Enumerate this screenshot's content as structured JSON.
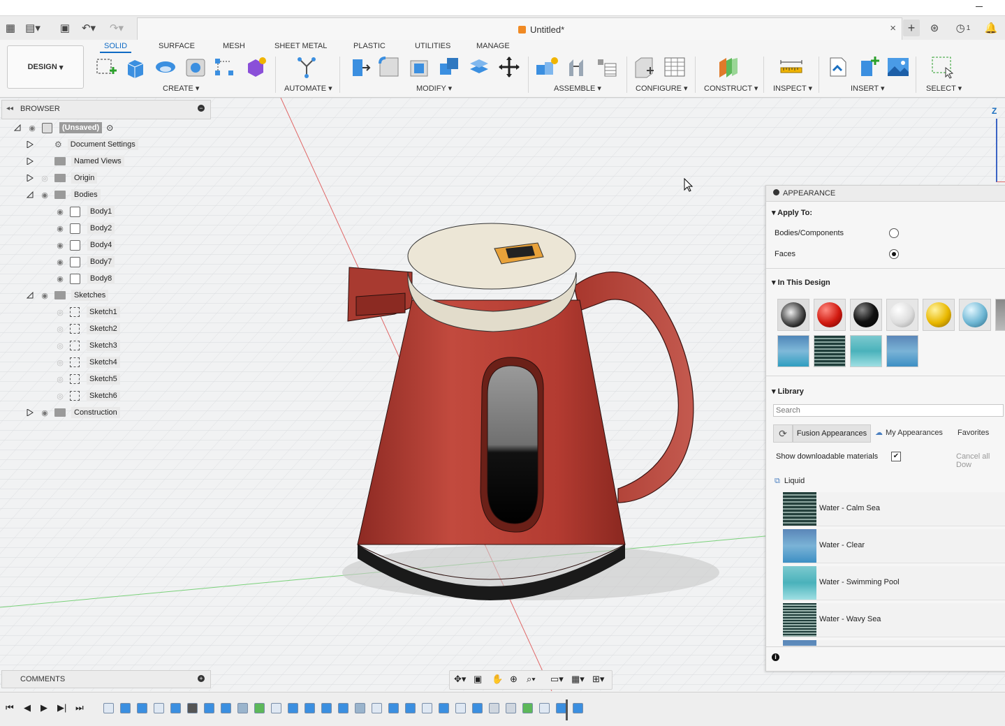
{
  "window": {
    "title": "Untitled*"
  },
  "toolbar": {
    "design_label": "DESIGN",
    "tabs": [
      {
        "label": "SOLID",
        "active": true
      },
      {
        "label": "SURFACE",
        "active": false
      },
      {
        "label": "MESH",
        "active": false
      },
      {
        "label": "SHEET METAL",
        "active": false
      },
      {
        "label": "PLASTIC",
        "active": false
      },
      {
        "label": "UTILITIES",
        "active": false
      },
      {
        "label": "MANAGE",
        "active": false
      }
    ],
    "groups": {
      "create": "CREATE",
      "automate": "AUTOMATE",
      "modify": "MODIFY",
      "assemble": "ASSEMBLE",
      "configure": "CONFIGURE",
      "construct": "CONSTRUCT",
      "inspect": "INSPECT",
      "insert": "INSERT",
      "select": "SELECT"
    }
  },
  "browser": {
    "title": "BROWSER",
    "root": "(Unsaved)",
    "items": [
      {
        "label": "Document Settings"
      },
      {
        "label": "Named Views"
      },
      {
        "label": "Origin"
      },
      {
        "label": "Bodies"
      },
      {
        "label": "Body1"
      },
      {
        "label": "Body2"
      },
      {
        "label": "Body4"
      },
      {
        "label": "Body7"
      },
      {
        "label": "Body8"
      },
      {
        "label": "Sketches"
      },
      {
        "label": "Sketch1"
      },
      {
        "label": "Sketch2"
      },
      {
        "label": "Sketch3"
      },
      {
        "label": "Sketch4"
      },
      {
        "label": "Sketch5"
      },
      {
        "label": "Sketch6"
      },
      {
        "label": "Construction"
      }
    ]
  },
  "comments": {
    "title": "COMMENTS"
  },
  "appearance": {
    "title": "APPEARANCE",
    "apply_to": "Apply To:",
    "bodies_components": "Bodies/Components",
    "faces": "Faces",
    "selected_apply": "Faces",
    "in_this_design": "In This Design",
    "library": "Library",
    "search_placeholder": "Search",
    "tab_fusion": "Fusion Appearances",
    "tab_my": "My Appearances",
    "tab_favorites": "Favorites",
    "show_downloadable": "Show downloadable materials",
    "show_downloadable_checked": true,
    "cancel_all": "Cancel all Dow",
    "category": "Liquid",
    "materials": [
      "Water - Calm Sea",
      "Water - Clear",
      "Water - Swimming Pool",
      "Water - Wavy Sea"
    ]
  },
  "viewcube": {
    "axis_label": "Z"
  },
  "colors": {
    "accent": "#0f6ac4",
    "kettle_body": "#b23a30",
    "lid": "#ece6d6"
  }
}
